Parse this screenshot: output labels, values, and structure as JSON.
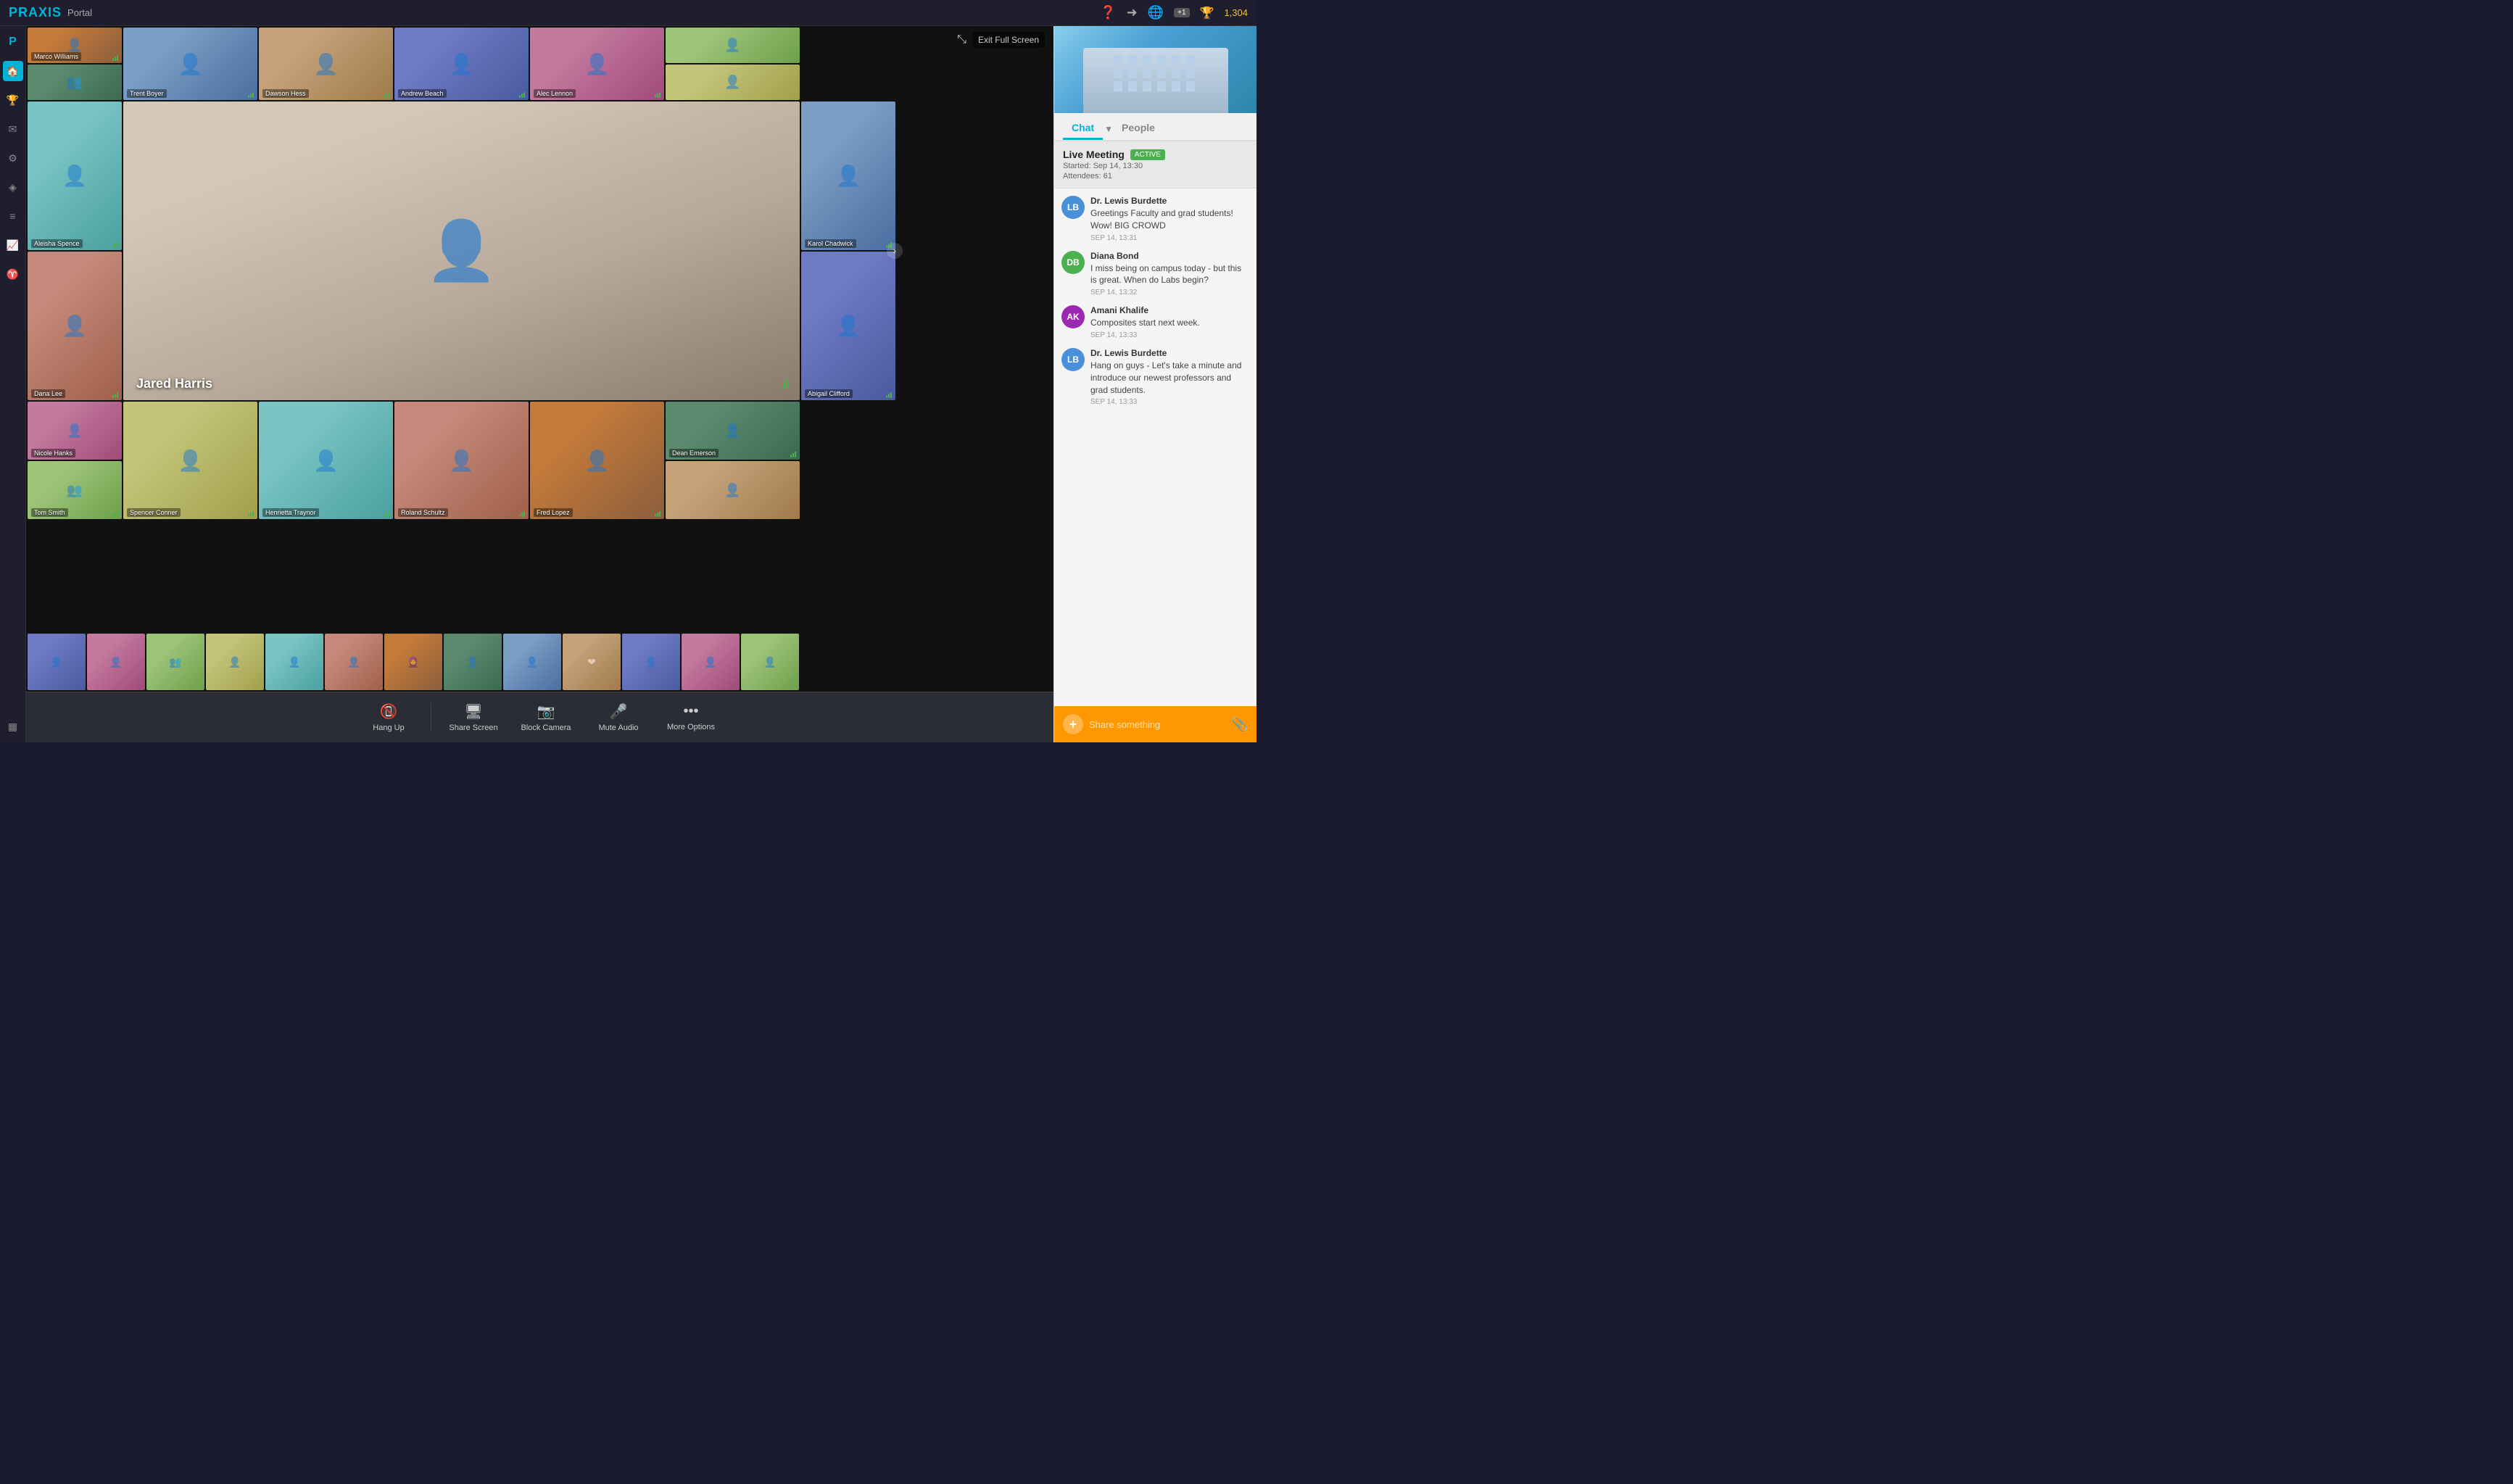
{
  "app": {
    "logo": "PRAXIS",
    "portal": "Portal"
  },
  "topnav": {
    "mail_badge": "+1",
    "trophy_score": "1,304",
    "icons": [
      "help-icon",
      "logout-icon",
      "globe-icon"
    ]
  },
  "video": {
    "exit_fullscreen_label": "Exit Full Screen",
    "main_speaker": "Jared Harris",
    "expand_label": "›",
    "participants": [
      {
        "name": "Marco Williams",
        "row": 1,
        "col": 1
      },
      {
        "name": "",
        "row": 1,
        "col": 1,
        "sub": true
      },
      {
        "name": "Trent Boyer",
        "row": 1,
        "col": 2
      },
      {
        "name": "Dawson Hess",
        "row": 1,
        "col": 3
      },
      {
        "name": "Andrew Beach",
        "row": 1,
        "col": 4
      },
      {
        "name": "Alec Lennon",
        "row": 1,
        "col": 5
      },
      {
        "name": "",
        "row": 1,
        "col": 6
      },
      {
        "name": "Aleisha Spence",
        "row": 2,
        "col": 1
      },
      {
        "name": "",
        "row": 2,
        "col": 1,
        "sub": true
      },
      {
        "name": "Karol Chadwick",
        "row": 2,
        "col": 6
      },
      {
        "name": "",
        "row": 2,
        "col": 6,
        "sub": true
      },
      {
        "name": "Dana Lee",
        "row": 3,
        "col": 1
      },
      {
        "name": "Abigail Clifford",
        "row": 3,
        "col": 6
      },
      {
        "name": "Nicole Hanks",
        "row": 4,
        "col": 1
      },
      {
        "name": "Dean Emerson",
        "row": 4,
        "col": 6
      },
      {
        "name": "Tom Smith",
        "row": 5,
        "col": 1
      },
      {
        "name": "Spencer Conner",
        "row": 5,
        "col": 2
      },
      {
        "name": "Henrietta Traynor",
        "row": 5,
        "col": 3
      },
      {
        "name": "Roland Schultz",
        "row": 5,
        "col": 4
      },
      {
        "name": "Fred Lopez",
        "row": 5,
        "col": 5
      },
      {
        "name": "",
        "row": 5,
        "col": 6
      }
    ],
    "small_participants_row1": [
      "p1",
      "p2",
      "p3",
      "p4",
      "p5",
      "p6",
      "p7",
      "p8",
      "p9",
      "p10",
      "p11",
      "p12",
      "p13"
    ],
    "small_participants_row2": [
      "p14",
      "p15",
      "p16",
      "p17",
      "p18",
      "p19",
      "p20",
      "p21",
      "p22",
      "p23",
      "p24",
      "p25",
      "p26"
    ]
  },
  "controls": {
    "hang_up": "Hang Up",
    "share_screen": "Share Screen",
    "block_camera": "Block Camera",
    "mute_audio": "Mute Audio",
    "more_options": "More Options"
  },
  "chat": {
    "tab_chat": "Chat",
    "tab_people": "People",
    "meeting_title": "Live Meeting",
    "meeting_active": "ACTIVE",
    "meeting_started": "Started: Sep 14, 13:30",
    "meeting_attendees": "Attendees: 61",
    "messages": [
      {
        "sender": "Dr. Lewis Burdette",
        "text": "Greetings Faculty and grad students! Wow! BIG CROWD",
        "time": "SEP 14, 13:31",
        "avatar_initials": "LB",
        "avatar_color": "av-blue"
      },
      {
        "sender": "Diana Bond",
        "text": "I miss being on campus today -  but this is great. When do Labs begin?",
        "time": "SEP 14, 13:32",
        "avatar_initials": "DB",
        "avatar_color": "av-green"
      },
      {
        "sender": "Amani Khalife",
        "text": "Composites start next week.",
        "time": "SEP 14, 13:33",
        "avatar_initials": "AK",
        "avatar_color": "av-purple"
      },
      {
        "sender": "Dr. Lewis Burdette",
        "text": "Hang on guys - Let's take a minute and introduce our newest professors and grad students.",
        "time": "SEP 14, 13:33",
        "avatar_initials": "LB",
        "avatar_color": "av-blue"
      }
    ],
    "input_placeholder": "Share something"
  }
}
